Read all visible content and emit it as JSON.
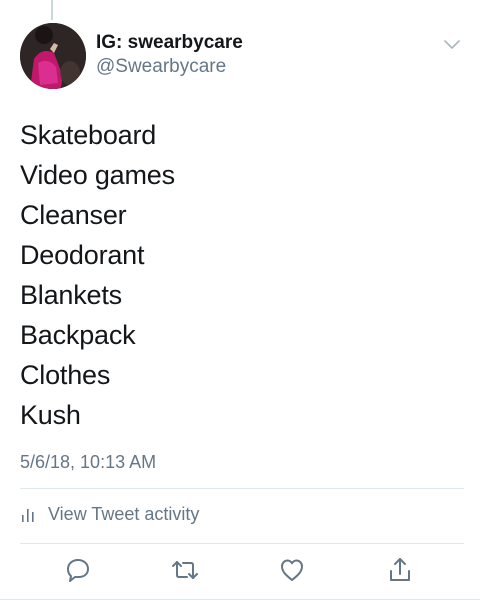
{
  "tweet": {
    "author": {
      "display_name": "IG: swearbycare",
      "handle": "@Swearbycare"
    },
    "lines": [
      "Skateboard",
      "Video games",
      "Cleanser",
      "Deodorant",
      "Blankets",
      "Backpack",
      "Clothes",
      "Kush"
    ],
    "timestamp": "5/6/18, 10:13 AM",
    "activity_label": "View Tweet activity"
  },
  "icons": {
    "menu": "chevron-down-icon",
    "activity": "bar-chart-icon",
    "reply": "reply-icon",
    "retweet": "retweet-icon",
    "like": "heart-icon",
    "share": "share-icon"
  },
  "colors": {
    "text_primary": "#14171a",
    "text_secondary": "#657786",
    "divider": "#e1e8ed",
    "icon": "#657786"
  }
}
